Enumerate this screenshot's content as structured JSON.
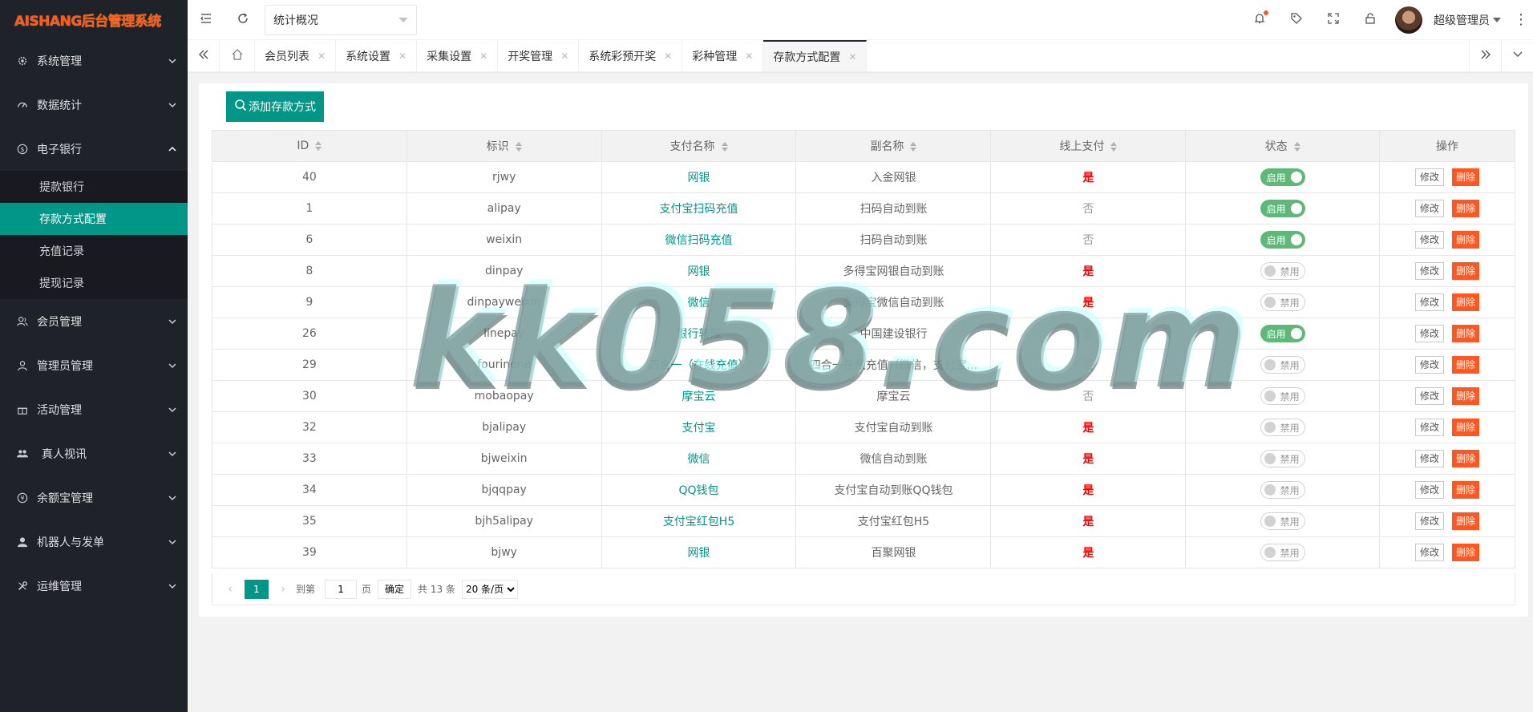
{
  "logo": "AISHANG后台管理系统",
  "sidebar": {
    "items": [
      {
        "label": "系统管理"
      },
      {
        "label": "数据统计"
      },
      {
        "label": "电子银行"
      },
      {
        "label": "会员管理"
      },
      {
        "label": "管理员管理"
      },
      {
        "label": "活动管理"
      },
      {
        "label": "真人视讯"
      },
      {
        "label": "余额宝管理"
      },
      {
        "label": "机器人与发单"
      },
      {
        "label": "运维管理"
      }
    ],
    "submenu": [
      "提款银行",
      "存款方式配置",
      "充值记录",
      "提现记录"
    ]
  },
  "header": {
    "select_value": "统计概况",
    "username": "超级管理员"
  },
  "tabs": [
    "会员列表",
    "系统设置",
    "采集设置",
    "开奖管理",
    "系统彩预开奖",
    "彩种管理",
    "存款方式配置"
  ],
  "toolbar": {
    "add_label": "添加存款方式"
  },
  "table": {
    "headers": [
      "ID",
      "标识",
      "支付名称",
      "副名称",
      "线上支付",
      "状态",
      "操作"
    ],
    "rows": [
      {
        "id": "40",
        "key": "rjwy",
        "name": "网银",
        "sub": "入金网银",
        "online": "是",
        "status": "启用"
      },
      {
        "id": "1",
        "key": "alipay",
        "name": "支付宝扫码充值",
        "sub": "扫码自动到账",
        "online": "否",
        "status": "启用"
      },
      {
        "id": "6",
        "key": "weixin",
        "name": "微信扫码充值",
        "sub": "扫码自动到账",
        "online": "否",
        "status": "启用"
      },
      {
        "id": "8",
        "key": "dinpay",
        "name": "网银",
        "sub": "多得宝网银自动到账",
        "online": "是",
        "status": "禁用"
      },
      {
        "id": "9",
        "key": "dinpayweixin",
        "name": "微信",
        "sub": "多得宝微信自动到账",
        "online": "是",
        "status": "禁用"
      },
      {
        "id": "26",
        "key": "linepay",
        "name": "银行转账",
        "sub": "中国建设银行",
        "online": "否",
        "status": "启用"
      },
      {
        "id": "29",
        "key": "fourinone",
        "name": "四合一（在线充值）",
        "sub": "四合一在线充值（微信，支付宝...",
        "online": "否",
        "status": "禁用"
      },
      {
        "id": "30",
        "key": "mobaopay",
        "name": "摩宝云",
        "sub": "摩宝云",
        "online": "否",
        "status": "禁用"
      },
      {
        "id": "32",
        "key": "bjalipay",
        "name": "支付宝",
        "sub": "支付宝自动到账",
        "online": "是",
        "status": "禁用"
      },
      {
        "id": "33",
        "key": "bjweixin",
        "name": "微信",
        "sub": "微信自动到账",
        "online": "是",
        "status": "禁用"
      },
      {
        "id": "34",
        "key": "bjqqpay",
        "name": "QQ钱包",
        "sub": "支付宝自动到账QQ钱包",
        "online": "是",
        "status": "禁用"
      },
      {
        "id": "35",
        "key": "bjh5alipay",
        "name": "支付宝红包H5",
        "sub": "支付宝红包H5",
        "online": "是",
        "status": "禁用"
      },
      {
        "id": "39",
        "key": "bjwy",
        "name": "网银",
        "sub": "百聚网银",
        "online": "是",
        "status": "禁用"
      }
    ],
    "edit_label": "修改",
    "delete_label": "删除"
  },
  "pager": {
    "current": "1",
    "goto_label": "到第",
    "page_value": "1",
    "page_unit": "页",
    "confirm": "确定",
    "total": "共 13 条",
    "page_size": "20 条/页"
  },
  "watermark": "kk058.com"
}
